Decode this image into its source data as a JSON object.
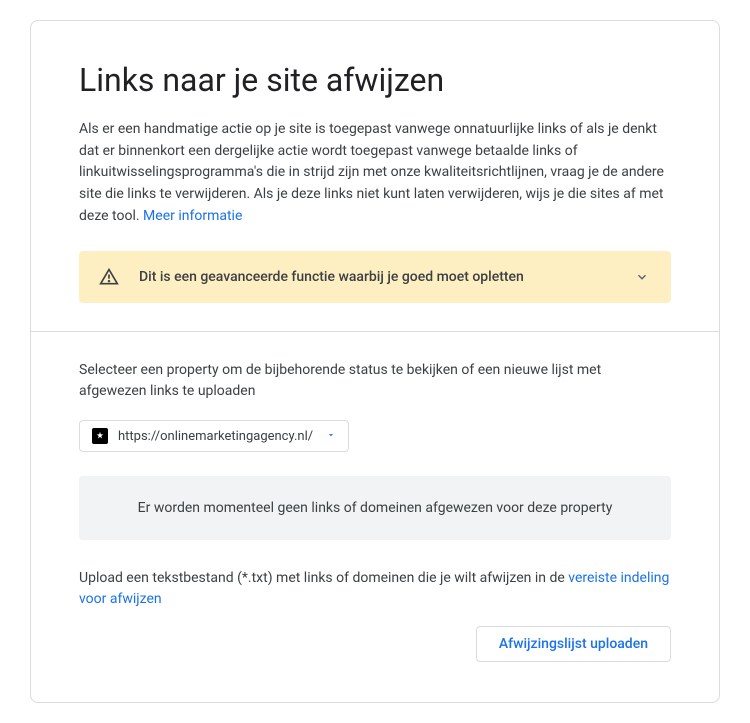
{
  "header": {
    "title": "Links naar je site afwijzen",
    "description": "Als er een handmatige actie op je site is toegepast vanwege onnatuurlijke links of als je denkt dat er binnenkort een dergelijke actie wordt toegepast vanwege betaalde links of linkuitwisselingsprogramma's die in strijd zijn met onze kwaliteitsrichtlijnen, vraag je de andere site die links te verwijderen. Als je deze links niet kunt laten verwijderen, wijs je die sites af met deze tool. ",
    "more_info_link": "Meer informatie"
  },
  "warning": {
    "text": "Dit is een geavanceerde functie waarbij je goed moet opletten"
  },
  "property": {
    "select_label": "Selecteer een property om de bijbehorende status te bekijken of een nieuwe lijst met afgewezen links te uploaden",
    "selected_url": "https://onlinemarketingagency.nl/"
  },
  "status": {
    "message": "Er worden momenteel geen links of domeinen afgewezen voor deze property"
  },
  "upload": {
    "description_before": "Upload een tekstbestand (*.txt) met links of domeinen die je wilt afwijzen in de ",
    "link_text": "vereiste indeling voor afwijzen",
    "button_label": "Afwijzingslijst uploaden"
  }
}
